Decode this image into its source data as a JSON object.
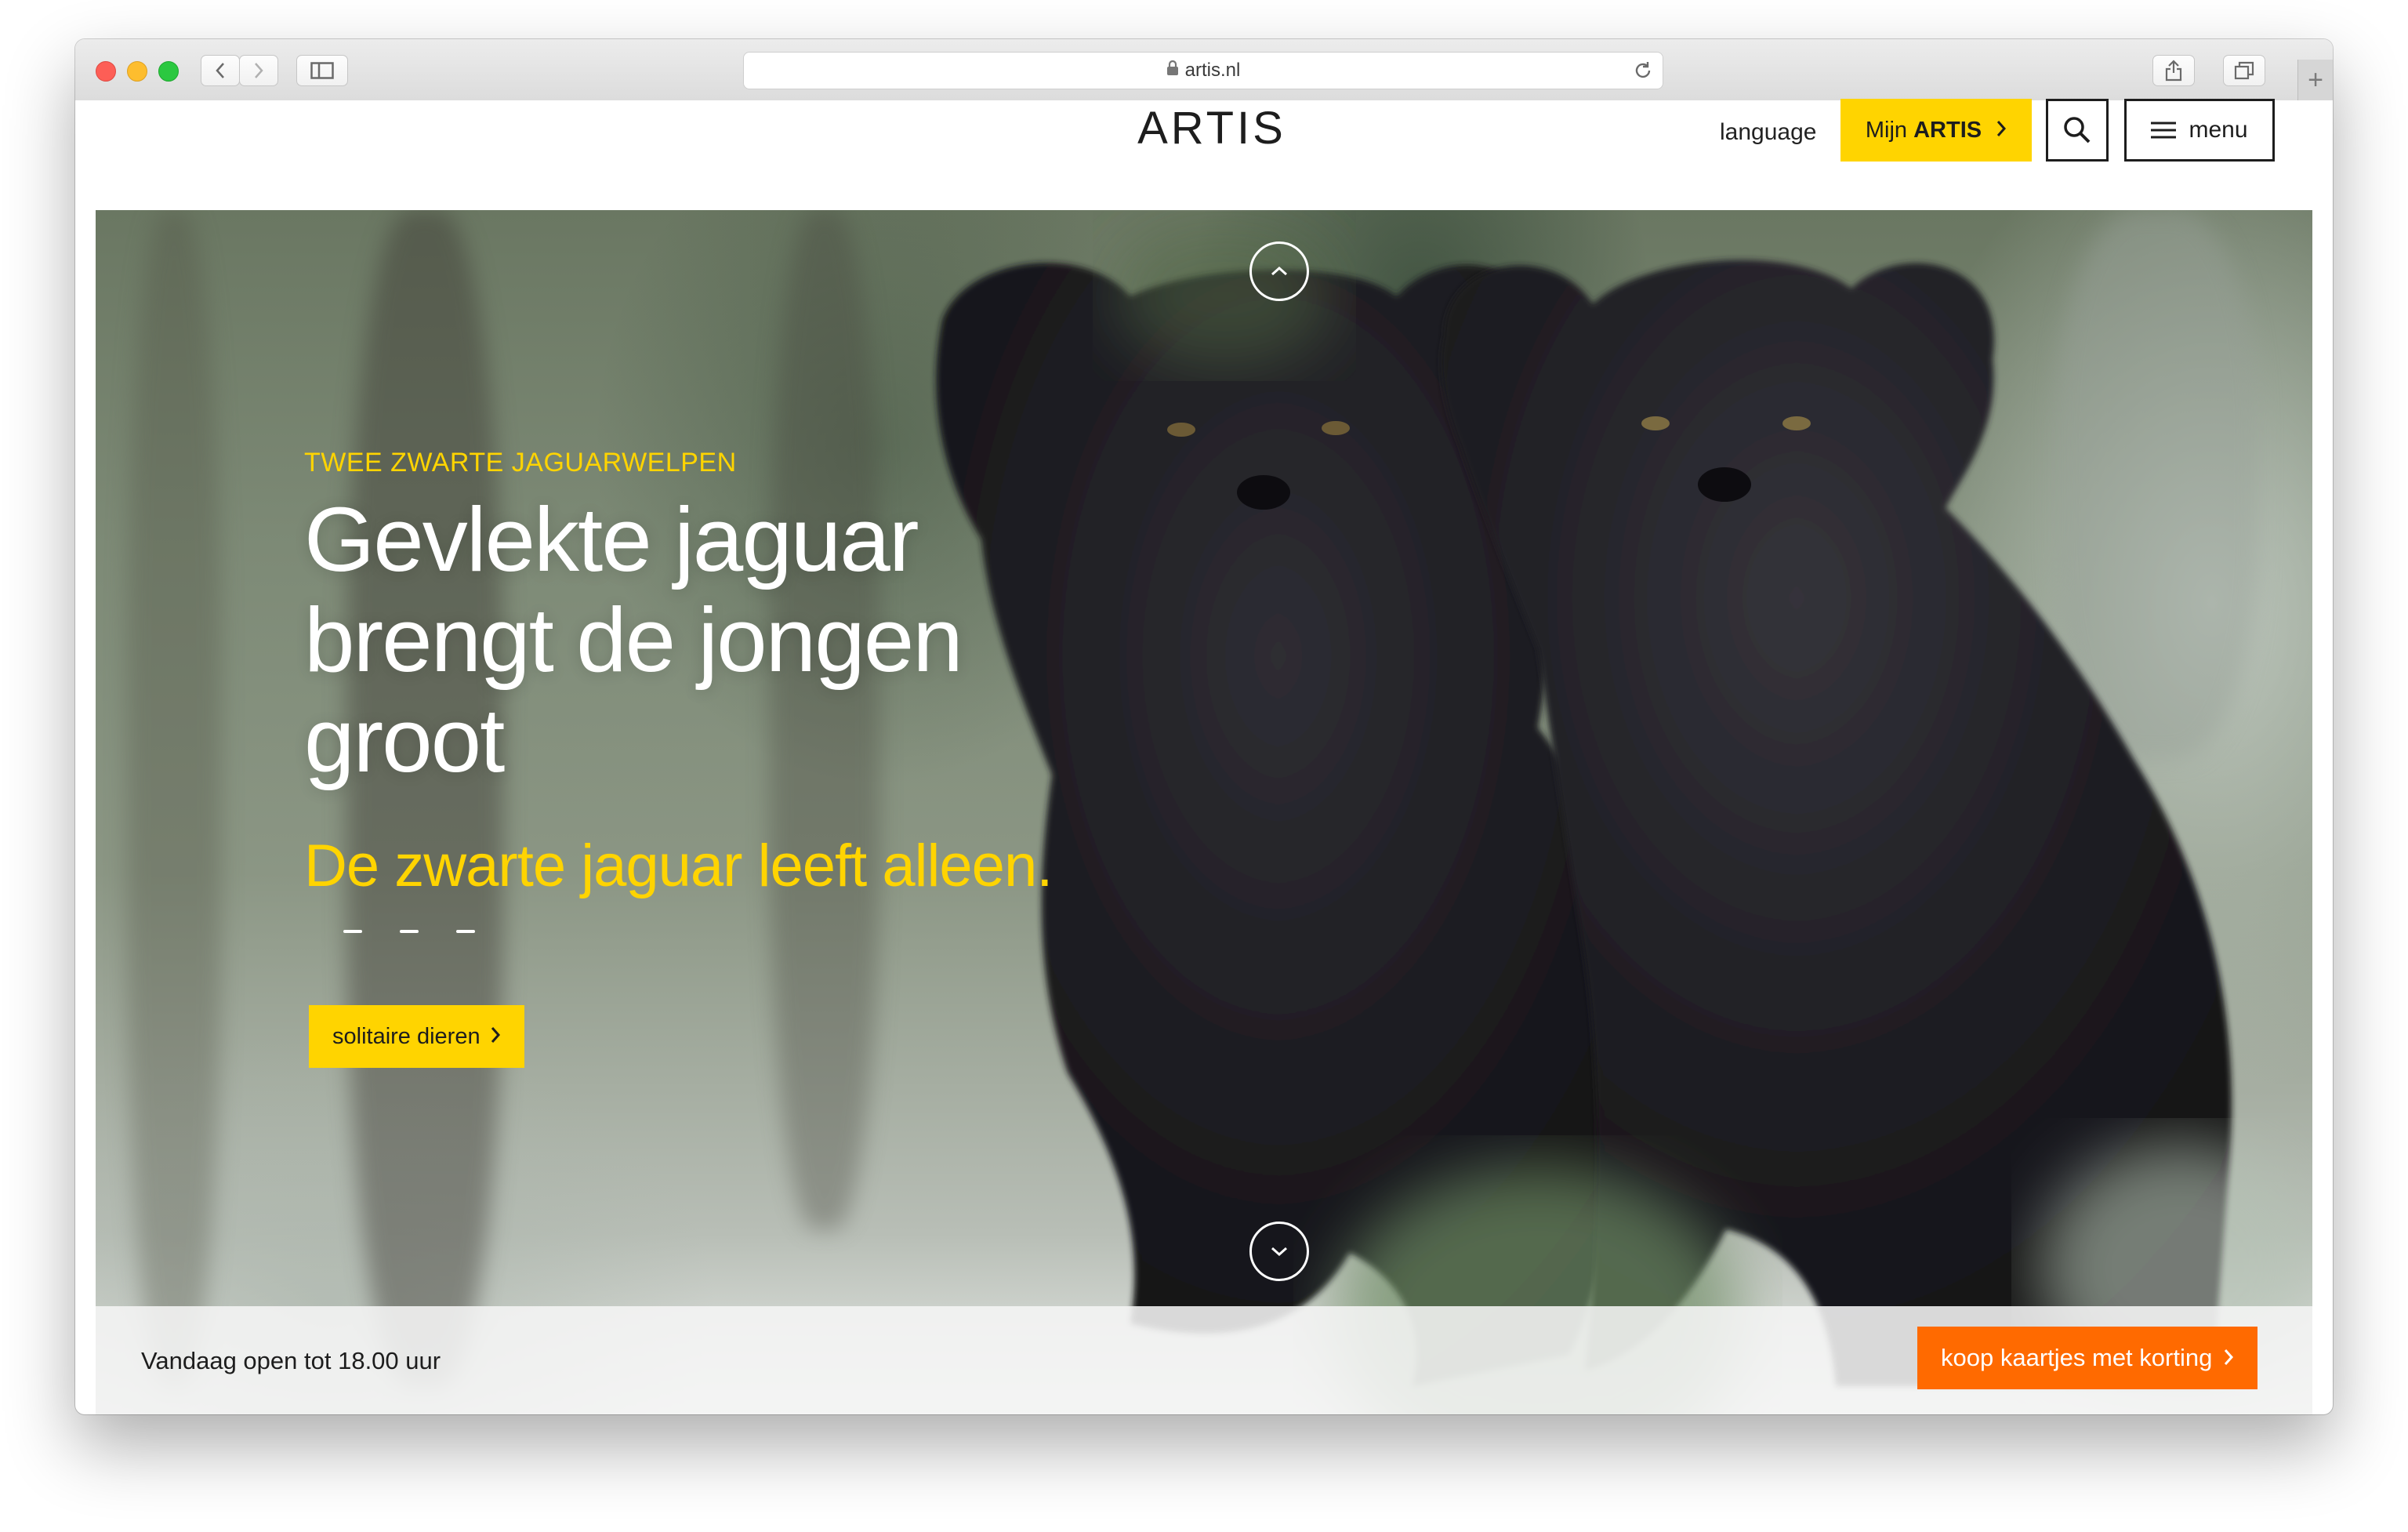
{
  "browser": {
    "url": "artis.nl",
    "new_tab_symbol": "+"
  },
  "header": {
    "logo": "ARTIS",
    "language_label": "language",
    "mijn_prefix": "Mijn ",
    "mijn_strong": "ARTIS",
    "menu_label": "menu"
  },
  "hero": {
    "eyebrow": "TWEE ZWARTE JAGUARWELPEN",
    "headline": "Gevlekte jaguar brengt de jongen groot",
    "tagline": "De zwarte jaguar leeft alleen.",
    "cta_label": "solitaire dieren",
    "slide_count": 3
  },
  "infobar": {
    "hours_text": "Vandaag open tot 18.00 uur",
    "tickets_label": "koop kaartjes met korting"
  },
  "colors": {
    "accent_yellow": "#ffd400",
    "ticket_orange": "#ff6a00",
    "text_dark": "#1d1d1d"
  },
  "icons": [
    "back-icon",
    "forward-icon",
    "sidebar-icon",
    "lock-icon",
    "reload-icon",
    "share-icon",
    "tabs-icon",
    "search-icon",
    "hamburger-icon",
    "chevron-right-icon",
    "chevron-up-icon",
    "chevron-down-icon"
  ]
}
